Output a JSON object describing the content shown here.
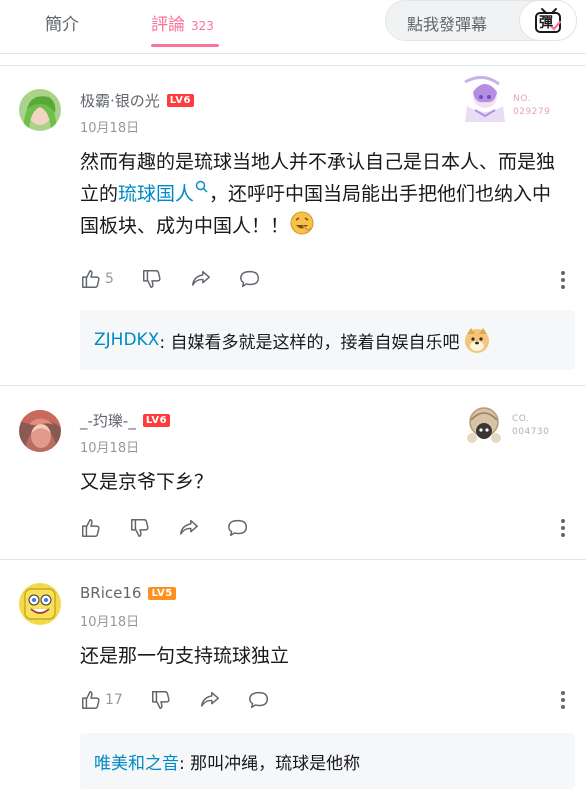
{
  "tabs": {
    "intro": "簡介",
    "comments": "評論",
    "comment_count": "323"
  },
  "danmaku": {
    "placeholder": "點我發彈幕",
    "icon_glyph": "彈"
  },
  "comments": [
    {
      "username": "极霸·银の光",
      "level": "LV6",
      "date": "10月18日",
      "text_1": "然而有趣的是琉球当地人并不承认自己是日本人、而是独立的",
      "link": "琉球国人",
      "text_2": "，还呼吁中国当局能出手把他们也纳入中国板块、成为中国人！！",
      "likes": "5",
      "fan_no": "NO.",
      "fan_id": "029279",
      "reply": {
        "user": "ZJHDKX",
        "text": ": 自媒看多就是这样的，接着自娱自乐吧"
      }
    },
    {
      "username": "_-玓瓅-_",
      "level": "LV6",
      "date": "10月18日",
      "text": "又是京爷下乡？",
      "fan_no": "CO.",
      "fan_id": "004730"
    },
    {
      "username": "BRice16",
      "level": "LV5",
      "date": "10月18日",
      "text": "还是那一句支持琉球独立",
      "likes": "17",
      "reply": {
        "user": "唯美和之音",
        "text": ": 那叫冲绳，琉球是他称"
      }
    }
  ],
  "colors": {
    "accent": "#fb7299",
    "link": "#008ac5",
    "level6": "#ff3b3b",
    "level5": "#ff8f1f"
  }
}
